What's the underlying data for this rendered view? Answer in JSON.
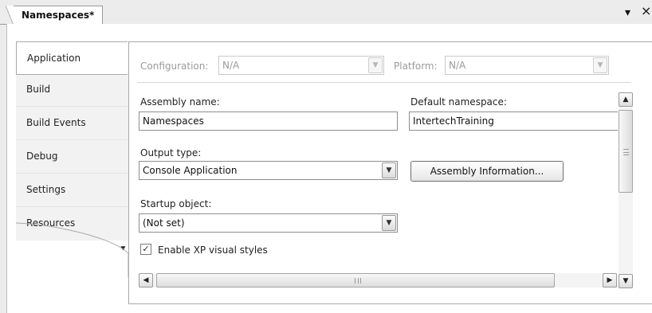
{
  "document_tab": {
    "title": "Namespaces*",
    "dropdown_glyph": "▾",
    "close_glyph": "×"
  },
  "sidebar": {
    "items": [
      {
        "label": "Application",
        "active": true
      },
      {
        "label": "Build"
      },
      {
        "label": "Build Events"
      },
      {
        "label": "Debug"
      },
      {
        "label": "Settings"
      },
      {
        "label": "Resources"
      }
    ],
    "more_glyph": "⯆"
  },
  "config": {
    "configuration_label": "Configuration:",
    "configuration_value": "N/A",
    "platform_label": "Platform:",
    "platform_value": "N/A"
  },
  "form": {
    "assembly_name_label": "Assembly name:",
    "assembly_name_value": "Namespaces",
    "default_namespace_label": "Default namespace:",
    "default_namespace_value": "IntertechTraining",
    "output_type_label": "Output type:",
    "output_type_value": "Console Application",
    "assembly_info_button": "Assembly Information...",
    "startup_object_label": "Startup object:",
    "startup_object_value": "(Not set)",
    "xp_styles_label": "Enable XP visual styles",
    "xp_styles_checked": true
  },
  "icons": {
    "dropdown": "chevron-down-icon",
    "scroll_up": "chevron-up-icon",
    "scroll_down": "chevron-down-icon",
    "scroll_left": "chevron-left-icon",
    "scroll_right": "chevron-right-icon",
    "check": "checkmark-icon"
  }
}
